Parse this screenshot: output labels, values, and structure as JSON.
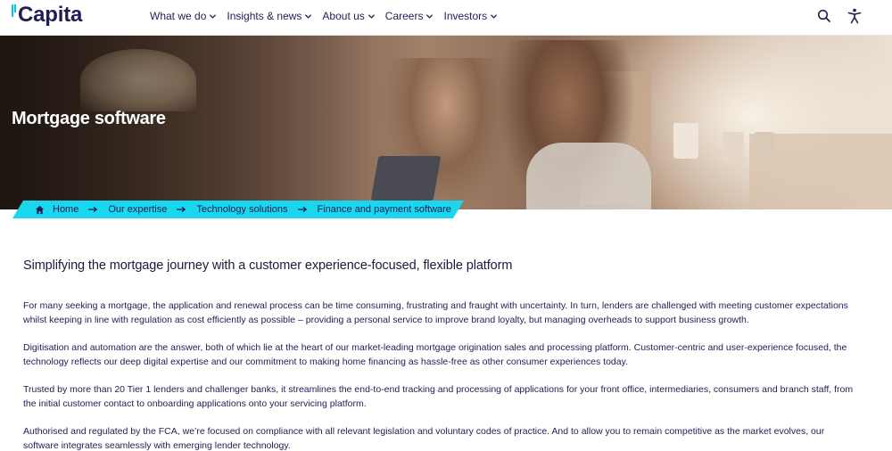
{
  "header": {
    "logo_text": "Capita",
    "brand_color": "#1e1e55",
    "accent_color": "#1ad7ef",
    "nav": [
      {
        "label": "What we do"
      },
      {
        "label": "Insights & news"
      },
      {
        "label": "About us"
      },
      {
        "label": "Careers"
      },
      {
        "label": "Investors"
      }
    ],
    "icons": [
      "search-icon",
      "accessibility-icon"
    ]
  },
  "hero": {
    "title": "Mortgage software"
  },
  "breadcrumb": {
    "items": [
      "Home",
      "Our expertise",
      "Technology solutions",
      "Finance and payment software"
    ]
  },
  "content": {
    "heading": "Simplifying the mortgage journey with a customer experience-focused, flexible platform",
    "paragraphs": [
      "For many seeking a mortgage, the application and renewal process can be time consuming, frustrating and fraught with uncertainty. In turn, lenders are challenged with meeting customer expectations whilst keeping in line with regulation as cost efficiently as possible – providing a personal service to improve brand loyalty, but managing overheads to support business growth.",
      "Digitisation and automation are the answer, both of which lie at the heart of our market-leading mortgage origination sales and processing platform. Customer-centric and user-experience focused, the technology reflects our deep digital expertise and our commitment to making home financing as hassle-free as other consumer experiences today.",
      "Trusted by more than 20 Tier 1 lenders and challenger banks, it streamlines the end-to-end tracking and processing of applications for your front office, intermediaries, consumers and branch staff, from the initial customer contact to onboarding applications onto your servicing platform.",
      "Authorised and regulated by the FCA, we’re focused on compliance with all relevant legislation and voluntary codes of practice. And to allow you to remain competitive as the market evolves, our software integrates seamlessly with emerging lender technology."
    ]
  }
}
